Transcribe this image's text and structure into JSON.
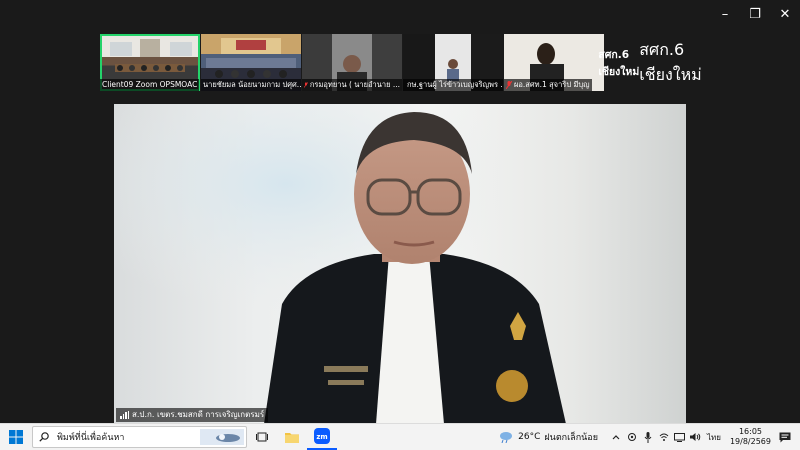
{
  "window": {
    "minimize": "–",
    "restore": "❐",
    "close": "✕"
  },
  "gallery": {
    "tiles": [
      {
        "label": "Client09 Zoom OPSMOAC",
        "muted": false,
        "active": true
      },
      {
        "label": "นายชัยมล  น้อยนามกาม ปศุศ...",
        "muted": false,
        "active": false
      },
      {
        "label": "กรมอุทยาน ( นายอำนาย ...",
        "muted": true,
        "active": false
      },
      {
        "label": "กษ.ฐานผู้  ไร่ข้าวเบญจริญพร ...",
        "muted": true,
        "active": false
      },
      {
        "label": "ผอ.สศท.1 สุจาริป มีบุญ",
        "muted": true,
        "active": false
      }
    ],
    "name_tile": {
      "title": "สศก.6 เชียงใหม่",
      "label": "สศก.6 เชียงใหม่"
    }
  },
  "speaker": {
    "label": "ส.ป.ก. เขตร.ชมสกดี  การเจริญเกตรมร์"
  },
  "taskbar": {
    "search_placeholder": "พิมพ์ที่นี่เพื่อค้นหา",
    "weather_temp": "26°C",
    "weather_desc": "ฝนตกเล็กน้อย",
    "language": "ไทย",
    "time": "16:05",
    "date": "19/8/2569"
  },
  "colors": {
    "active_outline": "#24d36a",
    "taskbar_bg": "#f3f3f3",
    "zoom_blue": "#0b5cff"
  }
}
